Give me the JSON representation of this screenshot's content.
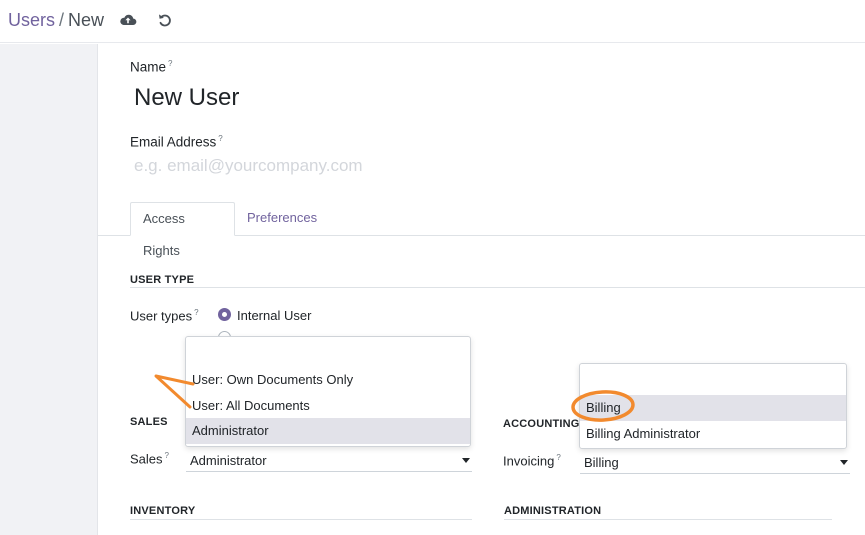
{
  "breadcrumb": {
    "parent": "Users",
    "separator": "/",
    "current": "New"
  },
  "toolbar": {
    "save_icon": "cloud-upload-icon",
    "discard_icon": "undo-icon"
  },
  "form": {
    "name_label": "Name",
    "name_value": "New User",
    "email_label": "Email Address",
    "email_placeholder": "e.g. email@yourcompany.com",
    "help_mark": "?"
  },
  "tabs": [
    {
      "label": "Access Rights",
      "active": true
    },
    {
      "label": "Preferences",
      "active": false
    }
  ],
  "user_type": {
    "section_title": "USER TYPE",
    "label": "User types",
    "options": [
      {
        "label": "Internal User",
        "checked": true
      }
    ]
  },
  "sales": {
    "section_title": "SALES",
    "label": "Sales",
    "value": "Administrator",
    "dropdown_options": [
      "",
      "User: Own Documents Only",
      "User: All Documents",
      "Administrator"
    ],
    "highlighted": "Administrator"
  },
  "accounting": {
    "section_title": "ACCOUNTING",
    "label": "Invoicing",
    "value": "Billing",
    "dropdown_options": [
      "",
      "Billing",
      "Billing Administrator"
    ],
    "highlighted": "Billing"
  },
  "inventory": {
    "section_title": "INVENTORY"
  },
  "administration": {
    "section_title": "ADMINISTRATION"
  },
  "colors": {
    "accent": "#71639e",
    "annotation": "#f28a2e",
    "highlight": "#e2e2e9",
    "sidebar": "#f1f2f5"
  }
}
